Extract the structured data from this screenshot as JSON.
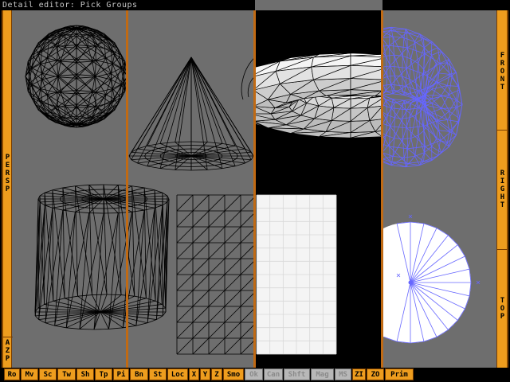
{
  "window": {
    "title": "Detail editor: Pick Groups"
  },
  "left_bar": {
    "view_label": "PERSP",
    "mode_label": "AZP"
  },
  "right_bar": {
    "views": [
      "FRONT",
      "RIGHT",
      "TOP"
    ]
  },
  "toolbar": {
    "buttons": [
      "Ro",
      "Mv",
      "Sc",
      "Tw",
      "Sh",
      "Tp",
      "Pi",
      "Bn",
      "St",
      "Loc",
      "X",
      "Y",
      "Z",
      "Smo",
      "Ok",
      "Can",
      "Shft",
      "Mag",
      "MS",
      "ZI",
      "ZO",
      "Prim"
    ],
    "disabled": [
      "Ok",
      "Can",
      "Shft",
      "Mag",
      "MS"
    ]
  },
  "colors": {
    "accent": "#ee9d1e",
    "viewport_bg": "#6e6e6e",
    "wire_selected": "#6666ff",
    "wire": "#000000",
    "highlight_face": "#ffffff"
  },
  "icons": [
    "sphere-mesh",
    "cone-mesh",
    "torus-mesh",
    "cylinder-mesh",
    "grid-mesh",
    "disc-mesh"
  ]
}
